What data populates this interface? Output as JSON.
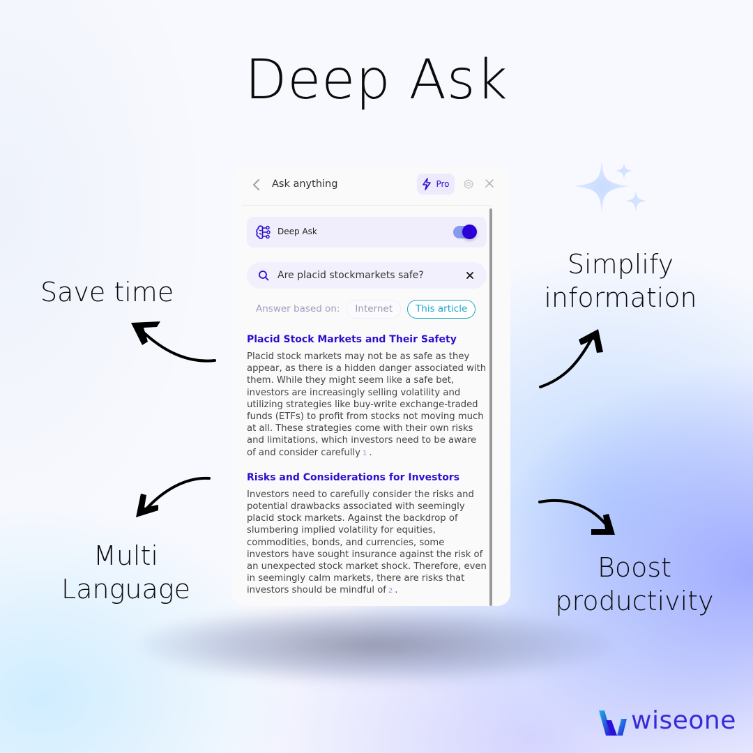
{
  "headline": "Deep Ask",
  "features": {
    "save_time": "Save time",
    "simplify_line1": "Simplify",
    "simplify_line2": "information",
    "multi_line1": "Multi",
    "multi_line2": "Language",
    "boost_line1": "Boost",
    "boost_line2": "productivity"
  },
  "panel": {
    "header": {
      "back_icon": "chevron-left-icon",
      "title": "Ask anything",
      "pro_label": "Pro",
      "pro_icon": "lightning-icon",
      "settings_icon": "gear-icon",
      "close_icon": "close-icon"
    },
    "deep_ask": {
      "icon": "brain-icon",
      "label": "Deep Ask",
      "enabled": true
    },
    "search": {
      "value": "Are placid stockmarkets safe?",
      "icon": "search-icon",
      "clear_icon": "close-icon"
    },
    "answer_based_on": {
      "label": "Answer based on:",
      "options": [
        "Internet",
        "This article"
      ],
      "selected": "This article"
    },
    "sections": [
      {
        "title": "Placid Stock Markets and Their Safety",
        "body": "Placid stock markets may not be as safe as they appear, as there is a hidden danger associated with them. While they might seem like a safe bet, investors are increasingly selling volatility and utilizing strategies like buy-write exchange-traded funds (ETFs) to profit from stocks not moving much at all. These strategies come with their own risks and limitations, which investors need to be aware of and consider carefully",
        "citation": "1",
        "end": "."
      },
      {
        "title": "Risks and Considerations for Investors",
        "body": "Investors need to carefully consider the risks and potential drawbacks associated with seemingly placid stock markets. Against the backdrop of slumbering implied volatility for equities, commodities, bonds, and currencies, some investors have sought insurance against the risk of an unexpected stock market shock. Therefore, even in seemingly calm markets, there are risks that investors should be mindful of",
        "citation": "2",
        "end": "."
      }
    ]
  },
  "brand": {
    "name": "wiseone",
    "accent": "#2b0fd0",
    "toggle_color": "#2b00d6",
    "chip_active_color": "#1aa5c8"
  }
}
